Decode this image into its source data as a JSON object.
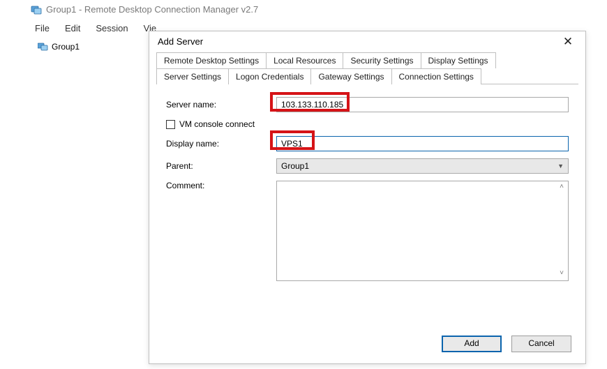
{
  "window": {
    "title": "Group1 - Remote Desktop Connection Manager v2.7"
  },
  "menu": {
    "file": "File",
    "edit": "Edit",
    "session": "Session",
    "view_truncated": "Vie"
  },
  "tree": {
    "root_label": "Group1"
  },
  "dialog": {
    "title": "Add Server",
    "tabs_row1": {
      "remote_desktop_settings": "Remote Desktop Settings",
      "local_resources": "Local Resources",
      "security_settings": "Security Settings",
      "display_settings": "Display Settings"
    },
    "tabs_row2": {
      "server_settings": "Server Settings",
      "logon_credentials": "Logon Credentials",
      "gateway_settings": "Gateway Settings",
      "connection_settings": "Connection Settings"
    },
    "fields": {
      "server_name_label": "Server name:",
      "server_name_value": "103.133.110.185",
      "vm_console_label": "VM console connect",
      "display_name_label": "Display name:",
      "display_name_value": "VPS1",
      "parent_label": "Parent:",
      "parent_value": "Group1",
      "comment_label": "Comment:"
    },
    "buttons": {
      "add": "Add",
      "cancel": "Cancel"
    }
  }
}
